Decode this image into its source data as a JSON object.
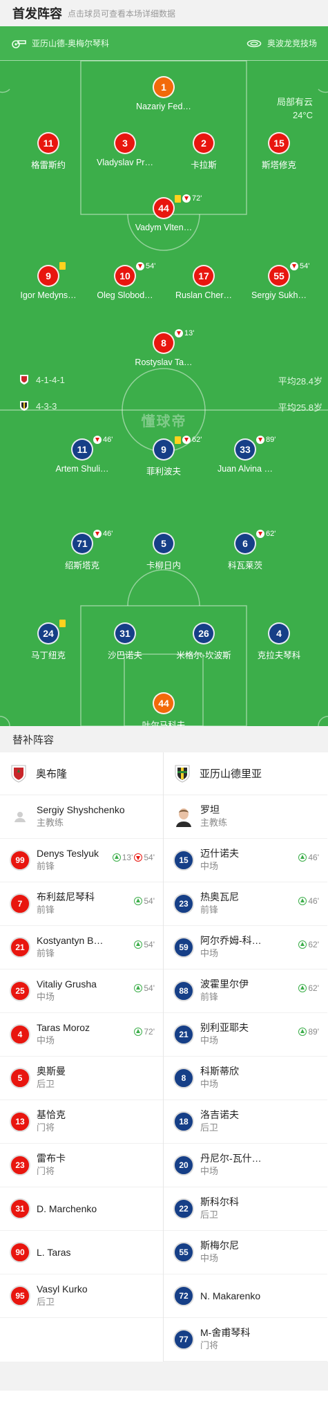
{
  "header": {
    "title": "首发阵容",
    "hint": "点击球员可查看本场详细数据"
  },
  "venue": {
    "left": "亚历山德-奥梅尔琴科",
    "right": "奥波龙竞技场"
  },
  "weather": {
    "desc": "局部有云",
    "temp": "24°C"
  },
  "watermark": "懂球帝",
  "home_team": {
    "formation": "4-1-4-1",
    "avg_age": "平均28.4岁"
  },
  "away_team": {
    "formation": "4-3-3",
    "avg_age": "平均25.8岁"
  },
  "home_players": [
    {
      "num": "1",
      "name": "Nazariy Fed…",
      "color": "orange",
      "events": []
    },
    {
      "num": "11",
      "name": "格雷斯约",
      "color": "red",
      "events": []
    },
    {
      "num": "3",
      "name": "Vladyslav Pr…",
      "color": "red",
      "events": []
    },
    {
      "num": "2",
      "name": "卡拉斯",
      "color": "red",
      "events": []
    },
    {
      "num": "15",
      "name": "斯塔修克",
      "color": "red",
      "events": []
    },
    {
      "num": "44",
      "name": "Vadym Vlten…",
      "color": "red",
      "events": [
        {
          "type": "yellow"
        },
        {
          "type": "out",
          "min": "72'"
        }
      ]
    },
    {
      "num": "9",
      "name": "Igor Medyns…",
      "color": "red",
      "events": [
        {
          "type": "yellow"
        }
      ]
    },
    {
      "num": "10",
      "name": "Oleg Slobod…",
      "color": "red",
      "events": [
        {
          "type": "out",
          "min": "54'"
        }
      ]
    },
    {
      "num": "17",
      "name": "Ruslan Cher…",
      "color": "red",
      "events": []
    },
    {
      "num": "55",
      "name": "Sergiy Sukh…",
      "color": "red",
      "events": [
        {
          "type": "out",
          "min": "54'"
        }
      ]
    },
    {
      "num": "8",
      "name": "Rostyslav Ta…",
      "color": "red",
      "events": [
        {
          "type": "out",
          "min": "13'"
        }
      ]
    }
  ],
  "away_players": [
    {
      "num": "11",
      "name": "Artem Shuli…",
      "color": "blue",
      "events": [
        {
          "type": "out",
          "min": "46'"
        }
      ]
    },
    {
      "num": "9",
      "name": "菲利波夫",
      "color": "blue",
      "events": [
        {
          "type": "yellow"
        },
        {
          "type": "out",
          "min": "62'"
        }
      ]
    },
    {
      "num": "33",
      "name": "Juan Alvina …",
      "color": "blue",
      "events": [
        {
          "type": "out",
          "min": "89'"
        }
      ]
    },
    {
      "num": "71",
      "name": "绍斯塔克",
      "color": "blue",
      "events": [
        {
          "type": "out",
          "min": "46'"
        }
      ]
    },
    {
      "num": "5",
      "name": "卡柳日内",
      "color": "blue",
      "events": []
    },
    {
      "num": "6",
      "name": "科瓦莱茨",
      "color": "blue",
      "events": [
        {
          "type": "out",
          "min": "62'"
        }
      ]
    },
    {
      "num": "24",
      "name": "马丁纽克",
      "color": "blue",
      "events": [
        {
          "type": "yellow"
        }
      ]
    },
    {
      "num": "31",
      "name": "沙巴诺夫",
      "color": "blue",
      "events": []
    },
    {
      "num": "26",
      "name": "米格尔-坎波斯",
      "color": "blue",
      "events": []
    },
    {
      "num": "4",
      "name": "克拉夫琴科",
      "color": "blue",
      "events": []
    },
    {
      "num": "44",
      "name": "叶尔马科夫",
      "color": "orange",
      "events": []
    }
  ],
  "subs": {
    "title": "替补阵容",
    "home": {
      "team": "奥布隆",
      "coach": {
        "name": "Sergiy Shyshchenko",
        "role": "主教练"
      },
      "players": [
        {
          "num": "99",
          "name": "Denys Teslyuk",
          "pos": "前锋",
          "events": [
            {
              "type": "in",
              "min": "13'"
            },
            {
              "type": "out",
              "min": "54'"
            }
          ]
        },
        {
          "num": "7",
          "name": "布利兹尼琴科",
          "pos": "前锋",
          "events": [
            {
              "type": "in",
              "min": "54'"
            }
          ]
        },
        {
          "num": "21",
          "name": "Kostyantyn B…",
          "pos": "前锋",
          "events": [
            {
              "type": "in",
              "min": "54'"
            }
          ]
        },
        {
          "num": "25",
          "name": "Vitaliy Grusha",
          "pos": "中场",
          "events": [
            {
              "type": "in",
              "min": "54'"
            }
          ]
        },
        {
          "num": "4",
          "name": "Taras Moroz",
          "pos": "中场",
          "events": [
            {
              "type": "in",
              "min": "72'"
            }
          ]
        },
        {
          "num": "5",
          "name": "奥斯曼",
          "pos": "后卫",
          "events": []
        },
        {
          "num": "13",
          "name": "基恰克",
          "pos": "门将",
          "events": []
        },
        {
          "num": "23",
          "name": "雷布卡",
          "pos": "门将",
          "events": []
        },
        {
          "num": "31",
          "name": "D. Marchenko",
          "pos": "",
          "events": []
        },
        {
          "num": "90",
          "name": "L. Taras",
          "pos": "",
          "events": []
        },
        {
          "num": "95",
          "name": "Vasyl Kurko",
          "pos": "后卫",
          "events": []
        }
      ]
    },
    "away": {
      "team": "亚历山德里亚",
      "coach": {
        "name": "罗坦",
        "role": "主教练"
      },
      "players": [
        {
          "num": "15",
          "name": "迈什诺夫",
          "pos": "中场",
          "events": [
            {
              "type": "in",
              "min": "46'"
            }
          ]
        },
        {
          "num": "23",
          "name": "热奥瓦尼",
          "pos": "前锋",
          "events": [
            {
              "type": "in",
              "min": "46'"
            }
          ]
        },
        {
          "num": "59",
          "name": "阿尔乔姆-科…",
          "pos": "中场",
          "events": [
            {
              "type": "in",
              "min": "62'"
            }
          ]
        },
        {
          "num": "88",
          "name": "波霍里尔伊",
          "pos": "前锋",
          "events": [
            {
              "type": "in",
              "min": "62'"
            }
          ]
        },
        {
          "num": "21",
          "name": "别利亚耶夫",
          "pos": "中场",
          "events": [
            {
              "type": "in",
              "min": "89'"
            }
          ]
        },
        {
          "num": "8",
          "name": "科斯蒂欣",
          "pos": "中场",
          "events": []
        },
        {
          "num": "18",
          "name": "洛吉诺夫",
          "pos": "后卫",
          "events": []
        },
        {
          "num": "20",
          "name": "丹尼尔-瓦什…",
          "pos": "中场",
          "events": []
        },
        {
          "num": "22",
          "name": "斯科尔科",
          "pos": "后卫",
          "events": []
        },
        {
          "num": "55",
          "name": "斯梅尔尼",
          "pos": "中场",
          "events": []
        },
        {
          "num": "72",
          "name": "N. Makarenko",
          "pos": "",
          "events": []
        },
        {
          "num": "77",
          "name": "M-舍甫琴科",
          "pos": "门将",
          "events": []
        }
      ]
    }
  }
}
